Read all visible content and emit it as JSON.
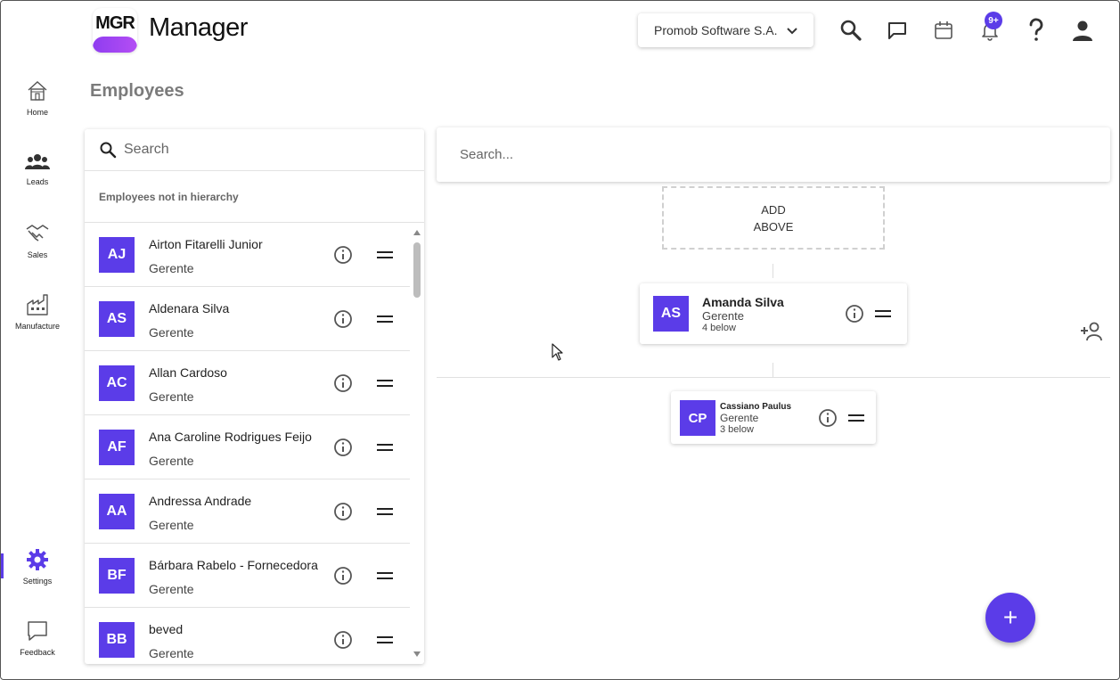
{
  "header": {
    "logo_text": "MGR",
    "app_title": "Manager",
    "company_selector": "Promob Software S.A.",
    "notification_badge": "9+"
  },
  "sidebar": {
    "items": [
      {
        "label": "Home",
        "icon": "home-icon"
      },
      {
        "label": "Leads",
        "icon": "people-icon"
      },
      {
        "label": "Sales",
        "icon": "handshake-icon"
      },
      {
        "label": "Manufacture",
        "icon": "factory-icon"
      },
      {
        "label": "Settings",
        "icon": "gear-icon",
        "active": true
      },
      {
        "label": "Feedback",
        "icon": "chat-bubble-icon"
      }
    ]
  },
  "page": {
    "title": "Employees"
  },
  "left_panel": {
    "search_placeholder": "Search",
    "section_title": "Employees not in hierarchy",
    "employees": [
      {
        "initials": "AJ",
        "name": "Airton Fitarelli Junior",
        "role": "Gerente"
      },
      {
        "initials": "AS",
        "name": "Aldenara Silva",
        "role": "Gerente"
      },
      {
        "initials": "AC",
        "name": "Allan Cardoso",
        "role": "Gerente"
      },
      {
        "initials": "AF",
        "name": "Ana Caroline Rodrigues Feijo",
        "role": "Gerente"
      },
      {
        "initials": "AA",
        "name": "Andressa Andrade",
        "role": "Gerente"
      },
      {
        "initials": "BF",
        "name": "Bárbara Rabelo - Fornecedora",
        "role": "Gerente"
      },
      {
        "initials": "BB",
        "name": "beved",
        "role": "Gerente"
      }
    ]
  },
  "hierarchy": {
    "search_placeholder": "Search...",
    "add_above_line1": "ADD",
    "add_above_line2": "ABOVE",
    "root": {
      "initials": "AS",
      "name": "Amanda Silva",
      "role": "Gerente",
      "below": "4 below"
    },
    "child": {
      "initials": "CP",
      "name": "Cassiano Paulus",
      "role": "Gerente",
      "below": "3 below"
    }
  },
  "fab_label": "+",
  "colors": {
    "accent": "#5b3ce8",
    "logo_gradient": "#8f3df0"
  }
}
